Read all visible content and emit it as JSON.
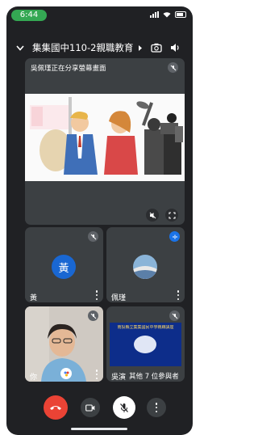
{
  "status": {
    "time": "6:44"
  },
  "meeting": {
    "title": "集集國中110-2親職教育…"
  },
  "share_tile": {
    "label": "吳佩瑾正在分享螢幕畫面"
  },
  "tiles": {
    "t1": {
      "initial": "黃",
      "name": "黃"
    },
    "t2": {
      "name": "佩瑾"
    },
    "t3": {
      "name": "你"
    },
    "t4": {
      "name": "吳演",
      "others": "其他 7 位參與者",
      "slide_title": "南投縣立集集國民中學親職講座"
    }
  },
  "colors": {
    "accent_blue": "#1a73e8",
    "end_call_red": "#ea4335",
    "avatar_blue": "#1967d2",
    "bg": "#202124",
    "tile": "#3c4043"
  },
  "icons": {
    "back": "chevron-down-icon",
    "cast": "cast-icon",
    "camera_switch": "switch-camera-icon",
    "speaker": "speaker-icon"
  }
}
